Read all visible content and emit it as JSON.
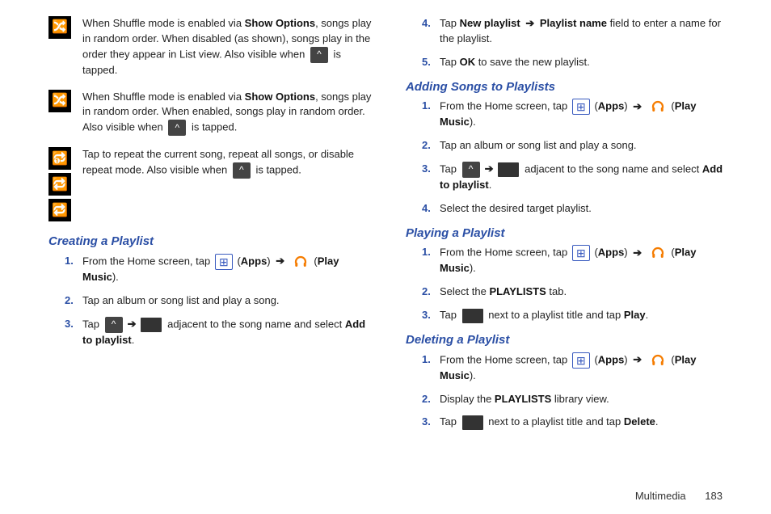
{
  "left": {
    "shuffle_off": {
      "t1": "When Shuffle mode is enabled via ",
      "b1": "Show Options",
      "t2": ", songs play in random order. When disabled (as shown), songs play in the order they appear in List view. Also visible when ",
      "t3": " is tapped."
    },
    "shuffle_on": {
      "t1": "When Shuffle mode is enabled via ",
      "b1": "Show Options",
      "t2": ", songs play in random order. When enabled, songs play in random order. Also visible when ",
      "t3": " is tapped."
    },
    "repeat": {
      "t1": "Tap to repeat the current song, repeat all songs, or disable repeat mode. Also visible when ",
      "t2": " is tapped."
    },
    "creating": {
      "heading": "Creating a Playlist",
      "s1a": "From the Home screen, tap ",
      "s1b": " (",
      "apps": "Apps",
      "s1c": ") ",
      "s1d": " (",
      "play_music": "Play Music",
      "s1e": ").",
      "s2": "Tap an album or song list and play a song.",
      "s3a": "Tap ",
      "s3b": " adjacent to the song name and select ",
      "s3bold": "Add to playlist",
      "s3c": "."
    }
  },
  "right": {
    "s4a": "Tap ",
    "s4b1": "New playlist",
    "s4arrow": " ",
    "s4b2": "Playlist name",
    "s4c": " field to enter a name for the playlist.",
    "s5a": "Tap ",
    "s5b": "OK",
    "s5c": " to save the new playlist.",
    "adding": {
      "heading": "Adding Songs to Playlists",
      "s1a": "From the Home screen, tap ",
      "s1b": " (",
      "apps": "Apps",
      "s1c": ") ",
      "s1d": " (",
      "play_music": "Play Music",
      "s1e": ").",
      "s2": "Tap an album or song list and play a song.",
      "s3a": "Tap ",
      "s3b": " adjacent to the song name and select ",
      "s3bold": "Add to playlist",
      "s3c": ".",
      "s4": "Select the desired target playlist."
    },
    "playing": {
      "heading": "Playing a Playlist",
      "s1a": "From the Home screen, tap ",
      "s1b": " (",
      "apps": "Apps",
      "s1c": ") ",
      "s1d": " (",
      "play_music": "Play Music",
      "s1e": ").",
      "s2a": "Select the ",
      "s2b": "PLAYLISTS",
      "s2c": " tab.",
      "s3a": "Tap ",
      "s3b": " next to a playlist title and tap ",
      "s3bold": "Play",
      "s3c": "."
    },
    "deleting": {
      "heading": "Deleting a Playlist",
      "s1a": "From the Home screen, tap ",
      "s1b": " (",
      "apps": "Apps",
      "s1c": ") ",
      "s1d": " (",
      "play_music": "Play Music",
      "s1e": ").",
      "s2a": "Display the ",
      "s2b": "PLAYLISTS",
      "s2c": " library view.",
      "s3a": "Tap ",
      "s3b": " next to a playlist title and tap ",
      "s3bold": "Delete",
      "s3c": "."
    }
  },
  "footer": {
    "section": "Multimedia",
    "page": "183"
  },
  "arrow": "➔"
}
